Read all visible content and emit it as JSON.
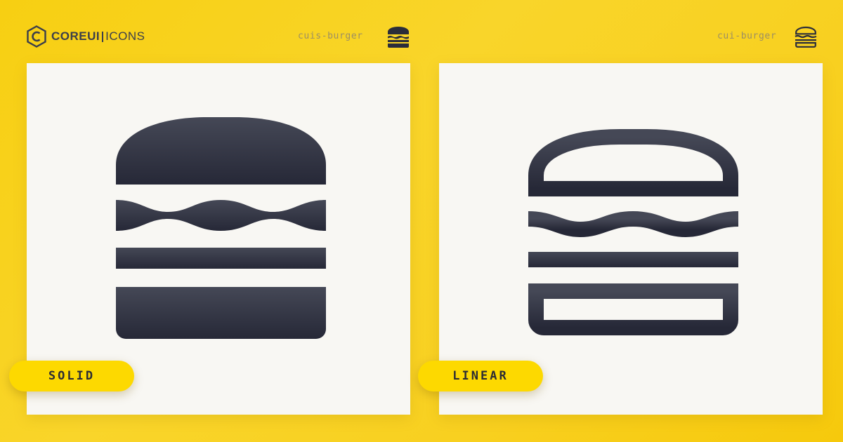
{
  "brand": {
    "name_bold": "COREUI",
    "name_light": "ICONS"
  },
  "variants": [
    {
      "icon_name": "cuis-burger",
      "label": "SOLID"
    },
    {
      "icon_name": "cui-burger",
      "label": "LINEAR"
    }
  ],
  "icon": {
    "name": "burger-icon"
  },
  "colors": {
    "background": "#f8d020",
    "panel": "#f8f7f3",
    "icon_top": "#454856",
    "icon_bottom": "#262837",
    "pill": "#fdd900",
    "mono_label": "#9c8f63"
  }
}
